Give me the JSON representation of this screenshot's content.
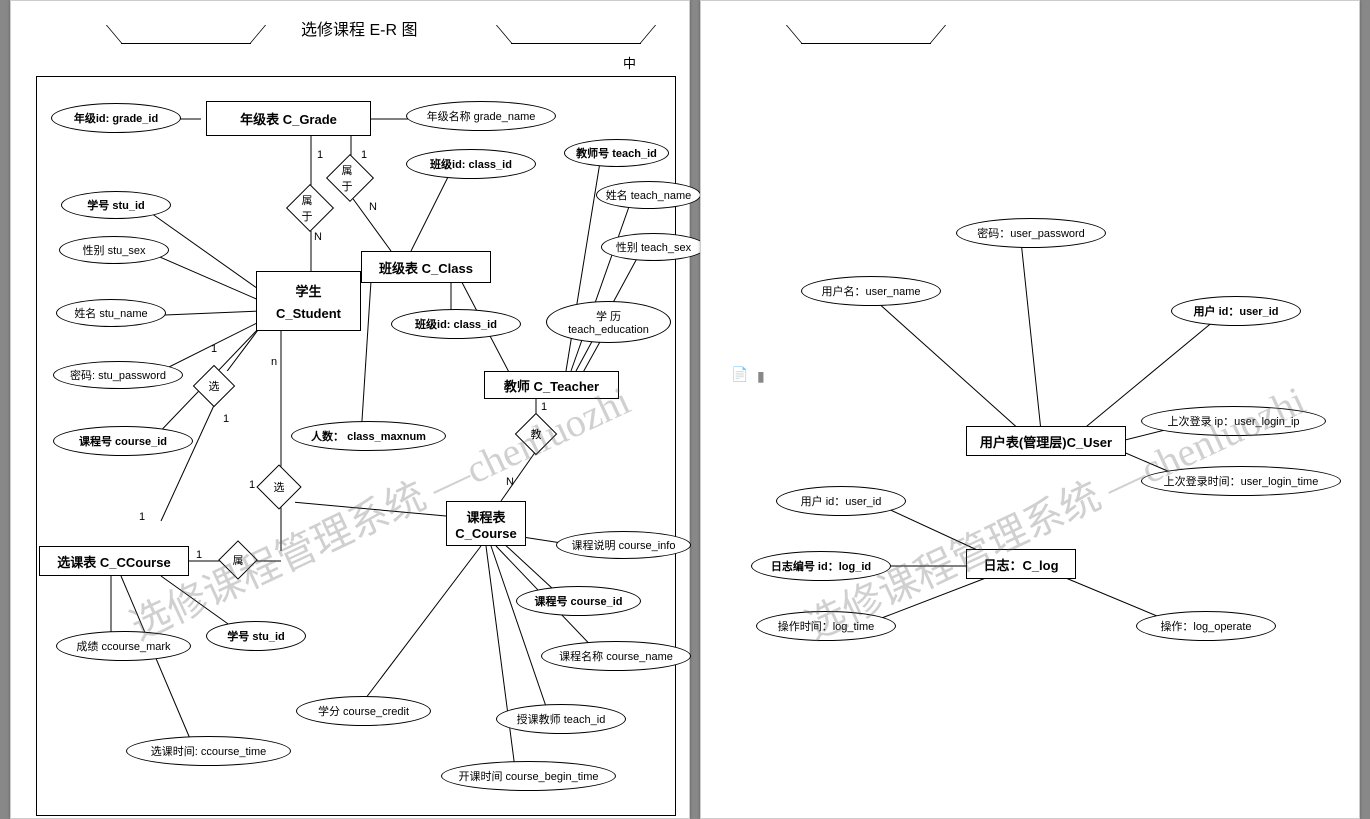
{
  "title": "选修课程 E-R 图",
  "corner_label": "中",
  "watermark1": "选修课程管理系统 —chenluozhi",
  "watermark2": "选修课程管理系统 —chenluozhi",
  "entities": {
    "grade": "年级表  C_Grade",
    "student_l1": "学生",
    "student_l2": "C_Student",
    "class": "班级表  C_Class",
    "teacher": "教师 C_Teacher",
    "course_l1": "课程表",
    "course_l2": "C_Course",
    "ccourse": "选课表 C_CCourse",
    "user": "用户表(管理层)C_User",
    "log": "日志：C_log"
  },
  "attrs": {
    "grade_id": "年级id: grade_id",
    "grade_name": "年级名称 grade_name",
    "class_id1": "班级id: class_id",
    "class_id2": "班级id: class_id",
    "class_maxnum": "人数： class_maxnum",
    "stu_id": "学号 stu_id",
    "stu_sex": "性别 stu_sex",
    "stu_name": "姓名 stu_name",
    "stu_password": "密码: stu_password",
    "stu_course_id": "课程号 course_id",
    "teach_id": "教师号 teach_id",
    "teach_name": "姓名 teach_name",
    "teach_sex": "性别 teach_sex",
    "teach_education_l1": "学            历",
    "teach_education_l2": "teach_education",
    "course_info": "课程说明 course_info",
    "course_id": "课程号 course_id",
    "course_name": "课程名称 course_name",
    "course_credit": "学分 course_credit",
    "course_teach_id": "授课教师 teach_id",
    "course_begin_time": "开课时间 course_begin_time",
    "ccourse_mark": "成绩 ccourse_mark",
    "ccourse_stu_id": "学号 stu_id",
    "ccourse_time": "选课时间: ccourse_time",
    "user_password": "密码：user_password",
    "user_name": "用户名：user_name",
    "user_id": "用户 id：user_id",
    "user_login_ip": "上次登录 ip：user_login_ip",
    "user_login_time": "上次登录时间：user_login_time",
    "log_user_id": "用户 id：user_id",
    "log_id": "日志编号 id：log_id",
    "log_time": "操作时间：log_time",
    "log_operate": "操作：log_operate"
  },
  "relations": {
    "belong1": "属于",
    "belong2": "属于",
    "select1": "选",
    "select2": "选",
    "attr_rel": "属",
    "teach": "教"
  },
  "cardinalities": {
    "c1": "1",
    "cN": "N",
    "cn_low": "n"
  }
}
